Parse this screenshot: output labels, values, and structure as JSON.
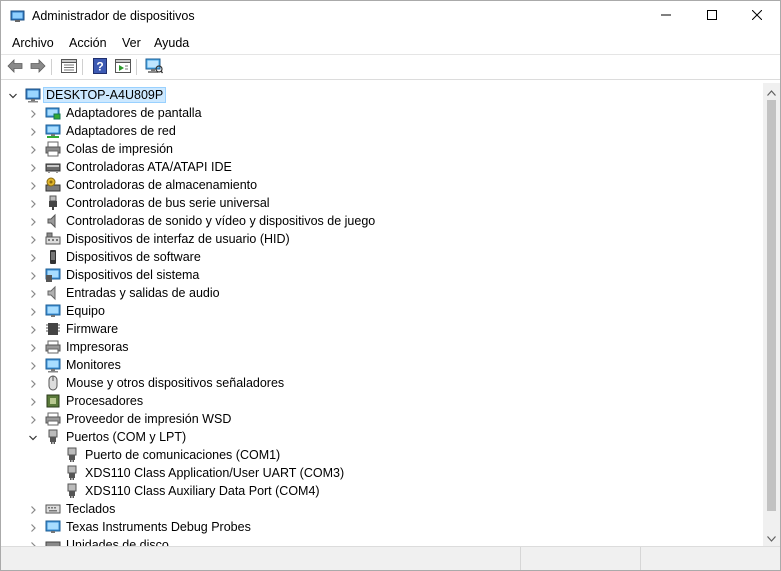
{
  "window": {
    "title": "Administrador de dispositivos",
    "controls": {
      "minimize_icon": "minimize-icon",
      "maximize_icon": "maximize-icon",
      "close_icon": "close-icon"
    }
  },
  "menu": {
    "items": [
      {
        "label": "Archivo"
      },
      {
        "label": "Acción"
      },
      {
        "label": "Ver"
      },
      {
        "label": "Ayuda"
      }
    ]
  },
  "toolbar": {
    "buttons": [
      "back-arrow-icon",
      "forward-arrow-icon",
      "properties-icon",
      "help-icon",
      "update-driver-icon",
      "scan-hardware-icon"
    ]
  },
  "tree": {
    "root": {
      "label": "DESKTOP-A4U809P",
      "expanded": true,
      "selected": true
    },
    "categories": [
      {
        "label": "Adaptadores de pantalla",
        "icon": "display-adapter-icon"
      },
      {
        "label": "Adaptadores de red",
        "icon": "network-adapter-icon"
      },
      {
        "label": "Colas de impresión",
        "icon": "print-queue-icon"
      },
      {
        "label": "Controladoras ATA/ATAPI IDE",
        "icon": "ide-controller-icon"
      },
      {
        "label": "Controladoras de almacenamiento",
        "icon": "storage-controller-icon"
      },
      {
        "label": "Controladoras de bus serie universal",
        "icon": "usb-icon"
      },
      {
        "label": "Controladoras de sonido y vídeo y dispositivos de juego",
        "icon": "speaker-icon"
      },
      {
        "label": "Dispositivos de interfaz de usuario (HID)",
        "icon": "hid-icon"
      },
      {
        "label": "Dispositivos de software",
        "icon": "software-device-icon"
      },
      {
        "label": "Dispositivos del sistema",
        "icon": "system-device-icon"
      },
      {
        "label": "Entradas y salidas de audio",
        "icon": "audio-io-icon"
      },
      {
        "label": "Equipo",
        "icon": "computer-icon"
      },
      {
        "label": "Firmware",
        "icon": "firmware-icon"
      },
      {
        "label": "Impresoras",
        "icon": "printer-icon"
      },
      {
        "label": "Monitores",
        "icon": "monitor-icon"
      },
      {
        "label": "Mouse y otros dispositivos señaladores",
        "icon": "mouse-icon"
      },
      {
        "label": "Procesadores",
        "icon": "processor-icon"
      },
      {
        "label": "Proveedor de impresión WSD",
        "icon": "wsd-print-icon"
      },
      {
        "label": "Puertos (COM y LPT)",
        "icon": "port-icon",
        "expanded": true,
        "children": [
          {
            "label": "Puerto de comunicaciones (COM1)",
            "icon": "port-icon"
          },
          {
            "label": "XDS110 Class Application/User UART (COM3)",
            "icon": "port-icon"
          },
          {
            "label": "XDS110 Class Auxiliary Data Port (COM4)",
            "icon": "port-icon"
          }
        ]
      },
      {
        "label": "Teclados",
        "icon": "keyboard-icon"
      },
      {
        "label": "Texas Instruments Debug Probes",
        "icon": "debug-probe-icon"
      },
      {
        "label": "Unidades de disco",
        "icon": "disk-drive-icon"
      }
    ]
  },
  "colors": {
    "selection_bg": "#cce8ff",
    "selection_border": "#99d1ff",
    "chrome_bg": "#f0f0f0"
  }
}
